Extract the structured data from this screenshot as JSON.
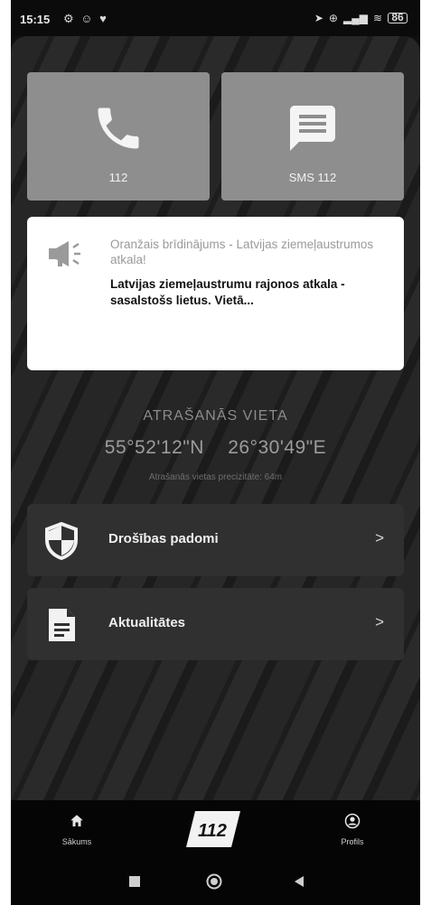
{
  "status_bar": {
    "time": "15:15",
    "notification_icons": "⚙ ☺ ♥",
    "battery": "86"
  },
  "tiles": {
    "call_label": "112",
    "sms_label": "SMS 112"
  },
  "alert": {
    "title": "Oranžais brīdinājums - Latvijas ziemeļaustrumos atkala!",
    "body": "Latvijas ziemeļaustrumu rajonos atkala - sasalstošs lietus. Vietā..."
  },
  "location": {
    "label": "ATRAŠANĀS VIETA",
    "latitude": "55°52'12\"N",
    "longitude": "26°30'49\"E",
    "precision": "Atrašanās vietas precizitāte: 64m"
  },
  "menu": {
    "safety_label": "Drošības padomi",
    "news_label": "Aktualitātes",
    "chevron": ">"
  },
  "bottom_nav": {
    "home_label": "Sākums",
    "profile_label": "Profils",
    "logo_text": "112"
  },
  "colors": {
    "background": "#0f0f0f",
    "tile": "#8e8e8e",
    "card": "#ffffff",
    "menu_row": "#303030"
  }
}
